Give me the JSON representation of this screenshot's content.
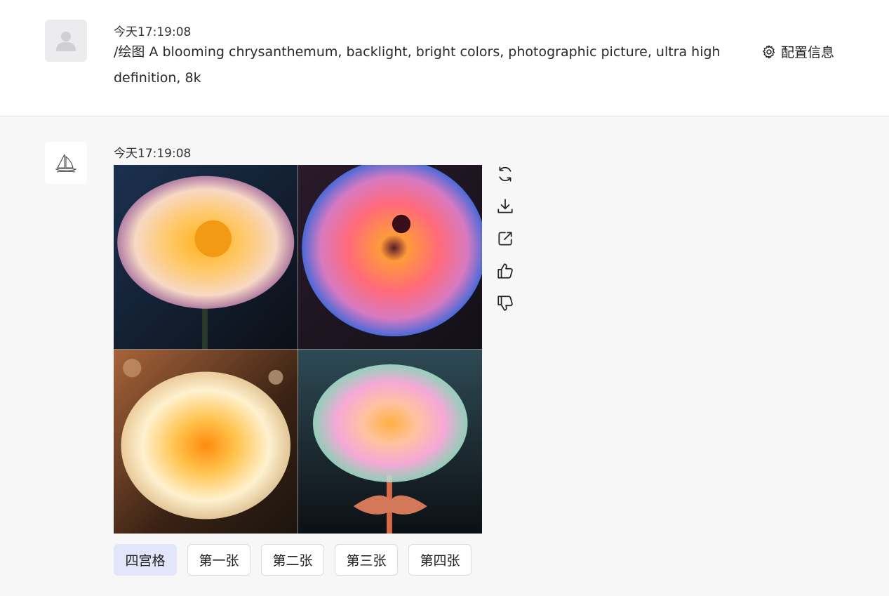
{
  "user_message": {
    "timestamp": "今天17:19:08",
    "prompt": "/绘图 A blooming chrysanthemum, backlight, bright colors, photographic picture, ultra high definition, 8k",
    "avatar_icon": "user-silhouette-icon",
    "config_label": "配置信息",
    "config_icon": "gear-icon"
  },
  "bot_message": {
    "timestamp": "今天17:19:08",
    "avatar_icon": "sailboat-logo-icon",
    "image_alt": "four chrysanthemum variations",
    "actions": [
      {
        "name": "refresh-icon"
      },
      {
        "name": "download-icon"
      },
      {
        "name": "share-icon"
      },
      {
        "name": "thumbs-up-icon"
      },
      {
        "name": "thumbs-down-icon"
      }
    ],
    "buttons": [
      {
        "label": "四宫格",
        "active": true
      },
      {
        "label": "第一张",
        "active": false
      },
      {
        "label": "第二张",
        "active": false
      },
      {
        "label": "第三张",
        "active": false
      },
      {
        "label": "第四张",
        "active": false
      }
    ]
  },
  "colors": {
    "active_button_bg": "#e3e5fb",
    "bot_bg": "#f7f7f8",
    "user_bg": "#ffffff"
  }
}
